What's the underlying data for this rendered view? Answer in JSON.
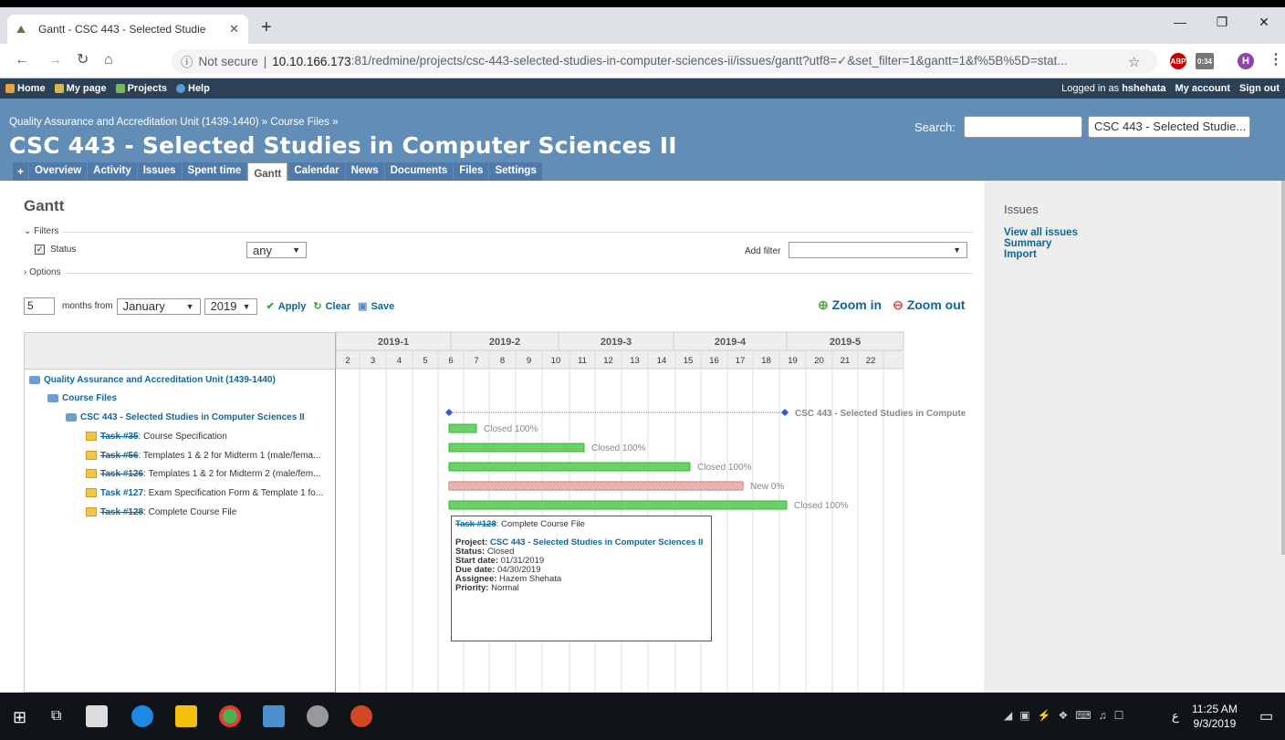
{
  "browser": {
    "tab_title": "Gantt - CSC 443 - Selected Studie",
    "url_prefix": "Not secure",
    "url_host": "10.10.166.173",
    "url_path": ":81/redmine/projects/csc-443-selected-studies-in-computer-sciences-ii/issues/gantt?utf8=✓&set_filter=1&gantt=1&f%5B%5D=stat...",
    "ext_abp": "ABP",
    "ext_time": "0:34",
    "profile": "H"
  },
  "topmenu": {
    "home": "Home",
    "mypage": "My page",
    "projects": "Projects",
    "help": "Help",
    "logged_prefix": "Logged in as",
    "user": "hshehata",
    "account": "My account",
    "signout": "Sign out"
  },
  "header": {
    "breadcrumb": "Quality Assurance and Accreditation Unit (1439-1440) » Course Files »",
    "title": "CSC 443 - Selected Studies in Computer Sciences II",
    "search_label": "Search:",
    "jump": "CSC 443 - Selected Studie..."
  },
  "mainmenu": {
    "plus": "+",
    "items": [
      "Overview",
      "Activity",
      "Issues",
      "Spent time",
      "Gantt",
      "Calendar",
      "News",
      "Documents",
      "Files",
      "Settings"
    ]
  },
  "page": {
    "title": "Gantt",
    "filters_legend": "Filters",
    "status_label": "Status",
    "status_op": "any",
    "add_filter": "Add filter",
    "options_legend": "Options",
    "months": "5",
    "months_from": "months from",
    "month": "January",
    "year": "2019",
    "apply": "Apply",
    "clear": "Clear",
    "save": "Save",
    "zoom_in": "Zoom in",
    "zoom_out": "Zoom out"
  },
  "sidebar": {
    "heading": "Issues",
    "links": [
      "View all issues",
      "Summary",
      "Import"
    ]
  },
  "gantt": {
    "months": [
      "2019-1",
      "2019-2",
      "2019-3",
      "2019-4",
      "2019-5"
    ],
    "weeks": [
      "2",
      "3",
      "4",
      "5",
      "6",
      "7",
      "8",
      "9",
      "10",
      "11",
      "12",
      "13",
      "14",
      "15",
      "16",
      "17",
      "18",
      "19",
      "20",
      "21",
      "22"
    ],
    "rows": [
      {
        "label": "Quality Assurance and Accreditation Unit (1439-1440)",
        "kind": "project"
      },
      {
        "label": "Course Files",
        "kind": "project"
      },
      {
        "label": "CSC 443 - Selected Studies in Computer Sciences II",
        "kind": "project"
      },
      {
        "ref": "Task #35",
        "label": ": Course Specification",
        "closed": true
      },
      {
        "ref": "Task #56",
        "label": ": Templates 1 & 2 for Midterm 1 (male/fema...",
        "closed": true
      },
      {
        "ref": "Task #126",
        "label": ": Templates 1 & 2 for Midterm 2 (male/fem...",
        "closed": true
      },
      {
        "ref": "Task #127",
        "label": ": Exam Specification Form & Template 1 fo...",
        "closed": false
      },
      {
        "ref": "Task #128",
        "label": ": Complete Course File",
        "closed": true
      }
    ],
    "bars": [
      {
        "label": "Closed 100%",
        "color": "#6ad16a"
      },
      {
        "label": "Closed 100%",
        "color": "#6ad16a"
      },
      {
        "label": "Closed 100%",
        "color": "#6ad16a"
      },
      {
        "label": "New 0%",
        "color": "#f29b9b"
      },
      {
        "label": "Closed 100%",
        "color": "#6ad16a"
      }
    ],
    "version_label": "CSC 443 - Selected Studies in Compute"
  },
  "tooltip": {
    "ref": "Task #128",
    "title": ": Complete Course File",
    "project_label": "Project:",
    "project": "CSC 443 - Selected Studies in Computer Sciences II",
    "status_label": "Status:",
    "status": "Closed",
    "start_label": "Start date:",
    "start": "01/31/2019",
    "due_label": "Due date:",
    "due": "04/30/2019",
    "assignee_label": "Assignee:",
    "assignee": "Hazem Shehata",
    "priority_label": "Priority:",
    "priority": "Normal"
  },
  "taskbar": {
    "time": "11:25 AM",
    "date": "9/3/2019",
    "lang": "ع"
  }
}
